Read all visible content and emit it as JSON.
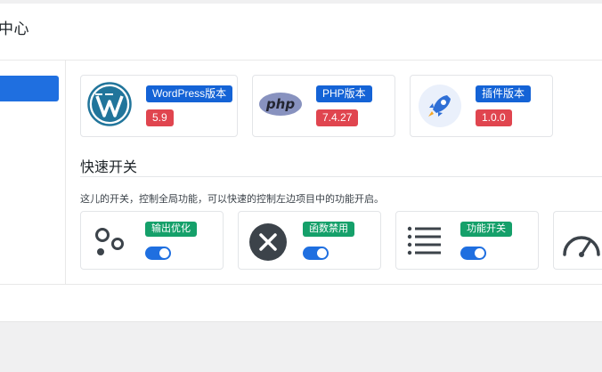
{
  "header": {
    "title": "中心"
  },
  "env_cards": [
    {
      "label": "WordPress版本",
      "value": "5.9",
      "icon": "wordpress-logo-icon"
    },
    {
      "label": "PHP版本",
      "value": "7.4.27",
      "icon": "php-logo-icon",
      "icon_text": "php"
    },
    {
      "label": "插件版本",
      "value": "1.0.0",
      "icon": "rocket-icon"
    }
  ],
  "quick_switch": {
    "title": "快速开关",
    "description": "这儿的开关，控制全局功能，可以快速的控制左边项目中的功能开启。",
    "items": [
      {
        "label": "输出优化",
        "icon": "circles-icon",
        "enabled": true
      },
      {
        "label": "函数禁用",
        "icon": "close-circle-icon",
        "enabled": true
      },
      {
        "label": "功能开关",
        "icon": "list-icon",
        "enabled": true
      },
      {
        "label": "",
        "icon": "speedometer-icon",
        "enabled": true
      }
    ]
  },
  "colors": {
    "accent": "#1f6fe0",
    "badge_blue": "#1463d6",
    "badge_red": "#e0454f",
    "badge_green": "#15a06a"
  }
}
